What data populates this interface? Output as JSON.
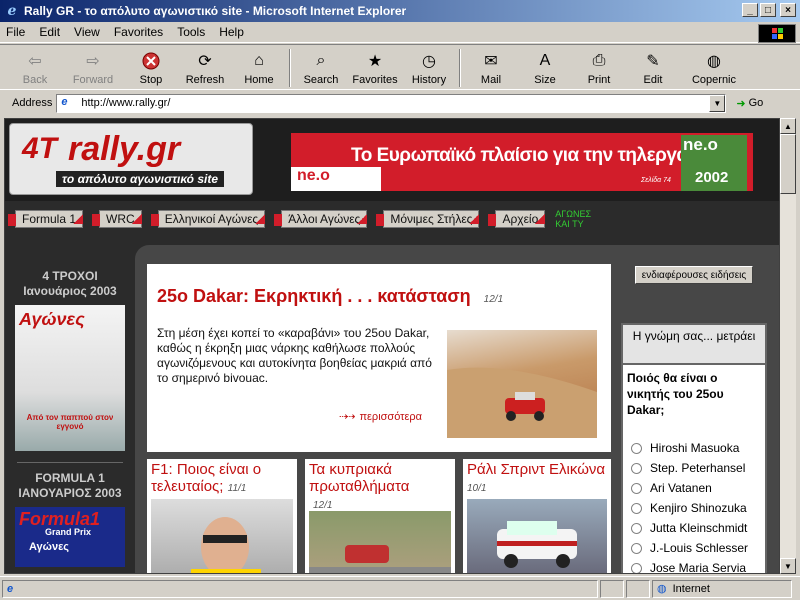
{
  "window": {
    "title": "Rally GR - το απόλυτο αγωνιστικό site - Microsoft Internet Explorer"
  },
  "menu": [
    "File",
    "Edit",
    "View",
    "Favorites",
    "Tools",
    "Help"
  ],
  "toolbar": {
    "back": "Back",
    "forward": "Forward",
    "stop": "Stop",
    "refresh": "Refresh",
    "home": "Home",
    "search": "Search",
    "favorites": "Favorites",
    "history": "History",
    "mail": "Mail",
    "size": "Size",
    "print": "Print",
    "edit": "Edit",
    "copernic": "Copernic"
  },
  "address": {
    "label": "Address",
    "url": "http://www.rally.gr/",
    "go": "Go"
  },
  "site": {
    "logo_text": "rally.gr",
    "logo_mark": "4T",
    "logo_tagline": "το απόλυτο αγωνιστικό site",
    "banner_text": "Το Ευρωπαϊκό πλαίσιο για την τηλεργασία",
    "banner_brand": "ne.o",
    "banner_brand_big": "ne.o",
    "banner_year": "2002",
    "banner_sub": "Σελίδα 74",
    "nav": [
      "Formula 1",
      "WRC",
      "Ελληνικοί Αγώνες",
      "Άλλοι Αγώνες",
      "Μόνιμες Στήλες",
      "Αρχείο"
    ],
    "nav_extra": "ΑΓΩΝΕΣ ΚΑΙ ΤΥ"
  },
  "left": {
    "mag1_title": "4 ΤΡΟΧΟΙ Ιανουάριος 2003",
    "mag1_name": "Αγώνες",
    "mag1_caption": "Από τον παππού στον εγγονό",
    "mag2_title": "FORMULA 1 ΙΑΝΟΥΑΡΙΟΣ 2003",
    "mag2_name": "Formula1",
    "mag2_sub": "Grand Prix",
    "mag2_caption": "Αγώνες"
  },
  "main": {
    "headline": "25ο Dakar: Εκρηκτική . . . κατάσταση",
    "date": "12/1",
    "body": "Στη μέση έχει κοπεί το «καραβάνι» του 25ου Dakar, καθώς η έκρηξη μιας νάρκης καθήλωσε πολλούς αγωνιζόμενους και αυτοκίνητα βοηθείας μακριά από το σημερινό bivouac.",
    "more": "περισσότερα"
  },
  "subs": [
    {
      "title": "F1:  Ποιος είναι ο τελευταίος;",
      "date": "11/1"
    },
    {
      "title": "Τα κυπριακά πρωταθλήματα",
      "date": "12/1"
    },
    {
      "title": "Ράλι Σπριντ Ελικώνα",
      "date": "10/1"
    }
  ],
  "side": {
    "news_button": "ενδιαφέρουσες ειδήσεις",
    "poll_head": "Η γνώμη σας... μετράει",
    "question": "Ποιός θα είναι ο νικητής του 25ου Dakar;",
    "options": [
      "Hiroshi Masuoka",
      "Step. Peterhansel",
      "Ari Vatanen",
      "Kenjiro Shinozuka",
      "Jutta Kleinschmidt",
      "J.-Louis Schlesser",
      "Jose Maria Servia"
    ]
  },
  "status": {
    "zone": "Internet"
  },
  "colors": {
    "accent": "#c01010",
    "banner": "#d21d2a",
    "page_bg": "#2b2b2b"
  }
}
